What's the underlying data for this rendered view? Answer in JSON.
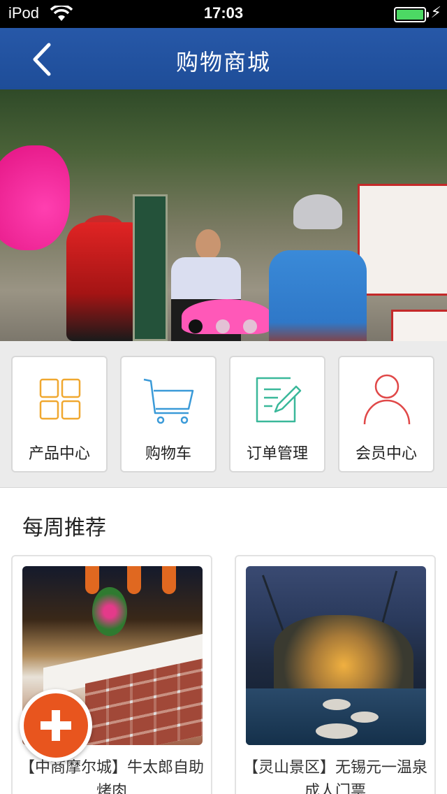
{
  "status_bar": {
    "carrier": "iPod",
    "time": "17:03",
    "icons": [
      "wifi-icon",
      "battery-icon",
      "charging-icon"
    ],
    "battery_color": "#4cd964"
  },
  "nav": {
    "title": "购物商城",
    "back_icon": "chevron-left-icon",
    "background_color": "#2758a8"
  },
  "banner": {
    "slide_count": 3,
    "active_slide": 1
  },
  "menu": [
    {
      "label": "产品中心",
      "icon": "grid-icon",
      "color": "#f0a830"
    },
    {
      "label": "购物车",
      "icon": "cart-icon",
      "color": "#3a9ad8"
    },
    {
      "label": "订单管理",
      "icon": "order-icon",
      "color": "#3ab89a"
    },
    {
      "label": "会员中心",
      "icon": "user-icon",
      "color": "#e04848"
    }
  ],
  "recommend": {
    "heading": "每周推荐",
    "items": [
      {
        "name": "【中商摩尔城】牛太郎自助烤肉",
        "image": "buffet-restaurant-photo"
      },
      {
        "name": "【灵山景区】无锡元一温泉成人门票",
        "image": "hot-spring-night-photo"
      }
    ]
  },
  "fab": {
    "icon": "plus-icon",
    "color": "#e8551e"
  }
}
